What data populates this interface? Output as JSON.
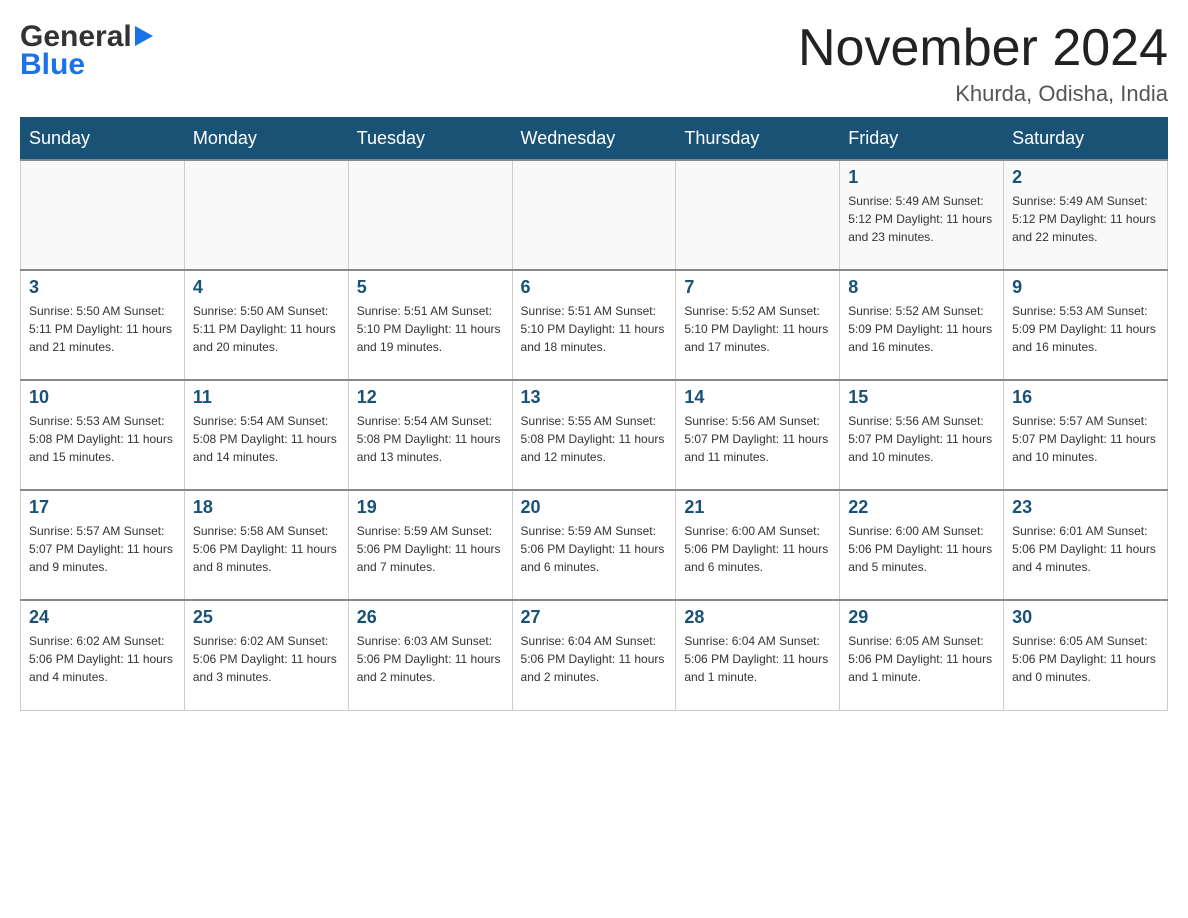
{
  "header": {
    "logo_general": "General",
    "logo_blue": "Blue",
    "month_title": "November 2024",
    "location": "Khurda, Odisha, India"
  },
  "weekdays": [
    "Sunday",
    "Monday",
    "Tuesday",
    "Wednesday",
    "Thursday",
    "Friday",
    "Saturday"
  ],
  "weeks": [
    [
      {
        "day": "",
        "info": ""
      },
      {
        "day": "",
        "info": ""
      },
      {
        "day": "",
        "info": ""
      },
      {
        "day": "",
        "info": ""
      },
      {
        "day": "",
        "info": ""
      },
      {
        "day": "1",
        "info": "Sunrise: 5:49 AM\nSunset: 5:12 PM\nDaylight: 11 hours\nand 23 minutes."
      },
      {
        "day": "2",
        "info": "Sunrise: 5:49 AM\nSunset: 5:12 PM\nDaylight: 11 hours\nand 22 minutes."
      }
    ],
    [
      {
        "day": "3",
        "info": "Sunrise: 5:50 AM\nSunset: 5:11 PM\nDaylight: 11 hours\nand 21 minutes."
      },
      {
        "day": "4",
        "info": "Sunrise: 5:50 AM\nSunset: 5:11 PM\nDaylight: 11 hours\nand 20 minutes."
      },
      {
        "day": "5",
        "info": "Sunrise: 5:51 AM\nSunset: 5:10 PM\nDaylight: 11 hours\nand 19 minutes."
      },
      {
        "day": "6",
        "info": "Sunrise: 5:51 AM\nSunset: 5:10 PM\nDaylight: 11 hours\nand 18 minutes."
      },
      {
        "day": "7",
        "info": "Sunrise: 5:52 AM\nSunset: 5:10 PM\nDaylight: 11 hours\nand 17 minutes."
      },
      {
        "day": "8",
        "info": "Sunrise: 5:52 AM\nSunset: 5:09 PM\nDaylight: 11 hours\nand 16 minutes."
      },
      {
        "day": "9",
        "info": "Sunrise: 5:53 AM\nSunset: 5:09 PM\nDaylight: 11 hours\nand 16 minutes."
      }
    ],
    [
      {
        "day": "10",
        "info": "Sunrise: 5:53 AM\nSunset: 5:08 PM\nDaylight: 11 hours\nand 15 minutes."
      },
      {
        "day": "11",
        "info": "Sunrise: 5:54 AM\nSunset: 5:08 PM\nDaylight: 11 hours\nand 14 minutes."
      },
      {
        "day": "12",
        "info": "Sunrise: 5:54 AM\nSunset: 5:08 PM\nDaylight: 11 hours\nand 13 minutes."
      },
      {
        "day": "13",
        "info": "Sunrise: 5:55 AM\nSunset: 5:08 PM\nDaylight: 11 hours\nand 12 minutes."
      },
      {
        "day": "14",
        "info": "Sunrise: 5:56 AM\nSunset: 5:07 PM\nDaylight: 11 hours\nand 11 minutes."
      },
      {
        "day": "15",
        "info": "Sunrise: 5:56 AM\nSunset: 5:07 PM\nDaylight: 11 hours\nand 10 minutes."
      },
      {
        "day": "16",
        "info": "Sunrise: 5:57 AM\nSunset: 5:07 PM\nDaylight: 11 hours\nand 10 minutes."
      }
    ],
    [
      {
        "day": "17",
        "info": "Sunrise: 5:57 AM\nSunset: 5:07 PM\nDaylight: 11 hours\nand 9 minutes."
      },
      {
        "day": "18",
        "info": "Sunrise: 5:58 AM\nSunset: 5:06 PM\nDaylight: 11 hours\nand 8 minutes."
      },
      {
        "day": "19",
        "info": "Sunrise: 5:59 AM\nSunset: 5:06 PM\nDaylight: 11 hours\nand 7 minutes."
      },
      {
        "day": "20",
        "info": "Sunrise: 5:59 AM\nSunset: 5:06 PM\nDaylight: 11 hours\nand 6 minutes."
      },
      {
        "day": "21",
        "info": "Sunrise: 6:00 AM\nSunset: 5:06 PM\nDaylight: 11 hours\nand 6 minutes."
      },
      {
        "day": "22",
        "info": "Sunrise: 6:00 AM\nSunset: 5:06 PM\nDaylight: 11 hours\nand 5 minutes."
      },
      {
        "day": "23",
        "info": "Sunrise: 6:01 AM\nSunset: 5:06 PM\nDaylight: 11 hours\nand 4 minutes."
      }
    ],
    [
      {
        "day": "24",
        "info": "Sunrise: 6:02 AM\nSunset: 5:06 PM\nDaylight: 11 hours\nand 4 minutes."
      },
      {
        "day": "25",
        "info": "Sunrise: 6:02 AM\nSunset: 5:06 PM\nDaylight: 11 hours\nand 3 minutes."
      },
      {
        "day": "26",
        "info": "Sunrise: 6:03 AM\nSunset: 5:06 PM\nDaylight: 11 hours\nand 2 minutes."
      },
      {
        "day": "27",
        "info": "Sunrise: 6:04 AM\nSunset: 5:06 PM\nDaylight: 11 hours\nand 2 minutes."
      },
      {
        "day": "28",
        "info": "Sunrise: 6:04 AM\nSunset: 5:06 PM\nDaylight: 11 hours\nand 1 minute."
      },
      {
        "day": "29",
        "info": "Sunrise: 6:05 AM\nSunset: 5:06 PM\nDaylight: 11 hours\nand 1 minute."
      },
      {
        "day": "30",
        "info": "Sunrise: 6:05 AM\nSunset: 5:06 PM\nDaylight: 11 hours\nand 0 minutes."
      }
    ]
  ]
}
